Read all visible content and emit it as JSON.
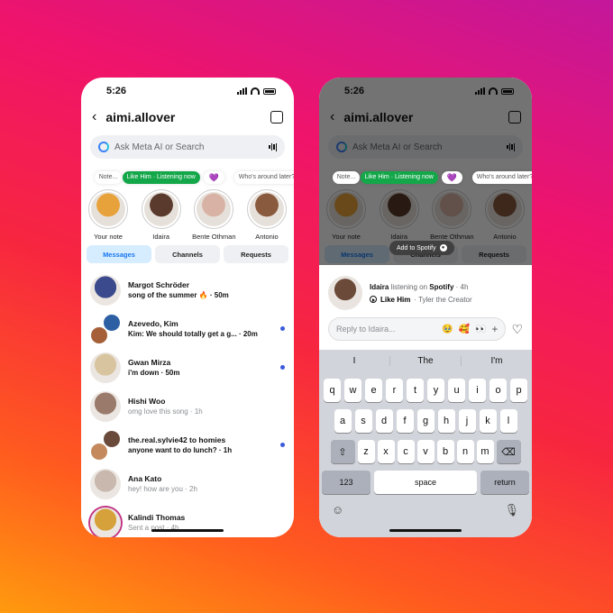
{
  "status_bar": {
    "time": "5:26"
  },
  "header": {
    "title": "aimi.allover",
    "back": "‹"
  },
  "search": {
    "placeholder": "Ask Meta AI or Search"
  },
  "notes": [
    {
      "bubble": "Note...",
      "name": "Your note",
      "style": "plain",
      "color": "#e8a23b"
    },
    {
      "bubble": "Like Him · Listening now",
      "name": "Idaira",
      "style": "green",
      "color": "#5a3a2c"
    },
    {
      "bubble": "💜",
      "name": "Bente Othman",
      "style": "heart",
      "color": "#d8b3a5"
    },
    {
      "bubble": "Who's around later?",
      "name": "Antonio",
      "style": "plain",
      "color": "#8a5a3e"
    }
  ],
  "tabs": [
    "Messages",
    "Channels",
    "Requests"
  ],
  "conversations": [
    {
      "name": "Margot Schröder",
      "message": "song of the summer 🔥 · 50m",
      "unread": true,
      "dot": false,
      "group": false,
      "colors": [
        "#3b4a8c"
      ]
    },
    {
      "name": "Azevedo, Kim",
      "message": "Kim: We should totally get a g... · 20m",
      "unread": true,
      "dot": true,
      "group": true,
      "colors": [
        "#2d5fa3",
        "#a5603a"
      ]
    },
    {
      "name": "Gwan Mirza",
      "message": "i'm down · 50m",
      "unread": true,
      "dot": true,
      "group": false,
      "colors": [
        "#d9c4a0"
      ]
    },
    {
      "name": "Hishi Woo",
      "message": "omg love this song · 1h",
      "unread": false,
      "dot": false,
      "group": false,
      "colors": [
        "#9a7a6b"
      ]
    },
    {
      "name": "the.real.sylvie42 to homies",
      "message": "anyone want to do lunch? · 1h",
      "unread": true,
      "dot": true,
      "group": true,
      "colors": [
        "#6a4a3a",
        "#c48a5e"
      ]
    },
    {
      "name": "Ana Kato",
      "message": "hey! how are you · 2h",
      "unread": false,
      "dot": false,
      "group": false,
      "colors": [
        "#c9b8ad"
      ]
    },
    {
      "name": "Kalindi Thomas",
      "message": "Sent a post · 4h",
      "unread": false,
      "dot": false,
      "group": false,
      "colors": [
        "#d6a13a"
      ]
    }
  ],
  "toast": {
    "label": "Add to Spotify"
  },
  "listening": {
    "user": "Idaira",
    "middle": "listening on",
    "service": "Spotify",
    "time": "· 4h",
    "song": "Like Him",
    "artist": "· Tyler the Creator"
  },
  "reply": {
    "placeholder": "Reply to Idaira...",
    "emojis": [
      "🥹",
      "🥰",
      "👀"
    ],
    "plus": "+",
    "heart": "♡"
  },
  "keyboard": {
    "suggestions": [
      "I",
      "The",
      "I'm"
    ],
    "row1": [
      "q",
      "w",
      "e",
      "r",
      "t",
      "y",
      "u",
      "i",
      "o",
      "p"
    ],
    "row2": [
      "a",
      "s",
      "d",
      "f",
      "g",
      "h",
      "j",
      "k",
      "l"
    ],
    "row3": [
      "z",
      "x",
      "c",
      "v",
      "b",
      "n",
      "m"
    ],
    "shift": "⇧",
    "delete": "⌫",
    "numbers": "123",
    "space": "space",
    "return": "return",
    "emoji": "☺",
    "mic": "🎙"
  }
}
